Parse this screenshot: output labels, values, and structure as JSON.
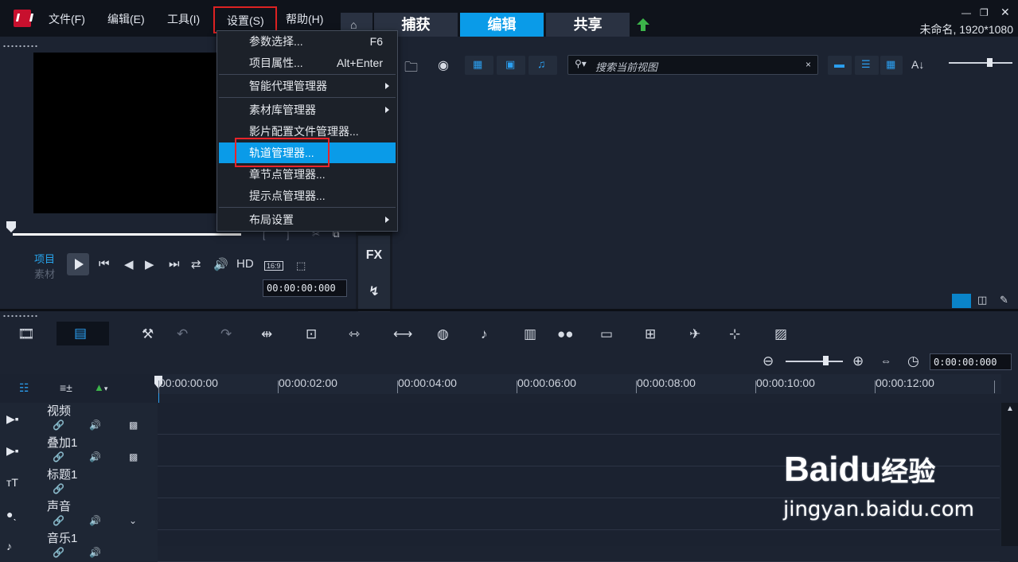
{
  "menubar": {
    "file": "文件(F)",
    "edit": "编辑(E)",
    "tools": "工具(I)",
    "settings": "设置(S)",
    "help": "帮助(H)"
  },
  "mode_tabs": {
    "capture": "捕获",
    "edit": "编辑",
    "share": "共享"
  },
  "window": {
    "project_name": "未命名, 1920*1080"
  },
  "settings_menu": [
    {
      "label": "参数选择...",
      "shortcut": "F6"
    },
    {
      "label": "项目属性...",
      "shortcut": "Alt+Enter"
    },
    {
      "label": "智能代理管理器"
    },
    {
      "label": "素材库管理器"
    },
    {
      "label": "影片配置文件管理器..."
    },
    {
      "label": "轨道管理器..."
    },
    {
      "label": "章节点管理器..."
    },
    {
      "label": "提示点管理器..."
    },
    {
      "label": "布局设置"
    }
  ],
  "player": {
    "project_label": "项目",
    "clip_label": "素材",
    "hd": "HD",
    "aspect": "16:9",
    "timecode": "00:00:00:000",
    "fx": "FX"
  },
  "library": {
    "search_placeholder": "搜索当前视图",
    "search_clear": "×"
  },
  "timeline": {
    "zoom_timecode": "0:00:00:000",
    "ruler": [
      "00:00:00:00",
      "00:00:02:00",
      "00:00:04:00",
      "00:00:06:00",
      "00:00:08:00",
      "00:00:10:00",
      "00:00:12:00"
    ],
    "tracks": [
      {
        "name": "视频",
        "icon": "video-track-icon"
      },
      {
        "name": "叠加1",
        "icon": "overlay-track-icon"
      },
      {
        "name": "标题1",
        "icon": "title-track-icon"
      },
      {
        "name": "声音",
        "icon": "voice-track-icon"
      },
      {
        "name": "音乐1",
        "icon": "music-track-icon"
      }
    ]
  },
  "watermark": {
    "brand": "Bai",
    "brand2": "du",
    "brand_cn": "经验",
    "url": "jingyan.baidu.com"
  }
}
